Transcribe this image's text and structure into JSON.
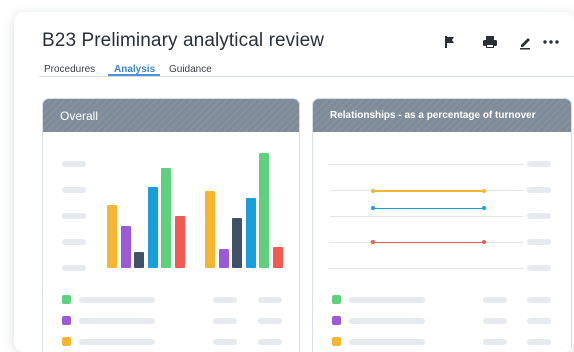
{
  "header": {
    "title": "B23 Preliminary analytical review"
  },
  "toolbar": {
    "items": [
      {
        "name": "flag-icon"
      },
      {
        "name": "print-icon"
      },
      {
        "name": "edit-icon"
      },
      {
        "name": "more-icon",
        "glyph": "•••"
      }
    ]
  },
  "tabs": [
    {
      "label": "Procedures",
      "active": false
    },
    {
      "label": "Analysis",
      "active": true
    },
    {
      "label": "Guidance",
      "active": false
    }
  ],
  "colors": {
    "accent": "#4f93d6",
    "panel_header": "#7f8b99",
    "series": [
      "#f5b731",
      "#9a5ad9",
      "#3f5166",
      "#189ed8",
      "#5fd17e",
      "#ef5b50"
    ]
  },
  "panels": {
    "overall": {
      "title": "Overall",
      "chart_data": {
        "type": "bar",
        "categories": [
          "",
          ""
        ],
        "series": [
          {
            "color": "#f5b731",
            "values": [
              60,
              73
            ]
          },
          {
            "color": "#9a5ad9",
            "values": [
              40,
              18
            ]
          },
          {
            "color": "#3f5166",
            "values": [
              15,
              48
            ]
          },
          {
            "color": "#189ed8",
            "values": [
              77,
              67
            ]
          },
          {
            "color": "#5fd17e",
            "values": [
              95,
              110
            ]
          },
          {
            "color": "#ef5b50",
            "values": [
              50,
              20
            ]
          }
        ],
        "ylim": [
          0,
          120
        ]
      }
    },
    "relationships": {
      "title": "Relationships - as a percentage of turnover",
      "chart_data": {
        "type": "line",
        "x": [
          0,
          1
        ],
        "series": [
          {
            "color": "#f5b731",
            "values": [
              4,
              4
            ]
          },
          {
            "color": "#189ed8",
            "values": [
              3,
              3
            ]
          },
          {
            "color": "#ef5b50",
            "values": [
              1,
              1
            ]
          }
        ],
        "ylim": [
          0,
          5
        ]
      }
    }
  },
  "legend": {
    "overall": [
      "#5fd17e",
      "#9a5ad9",
      "#f5b731"
    ],
    "relationships": [
      "#5fd17e",
      "#9a5ad9",
      "#f5b731"
    ]
  }
}
